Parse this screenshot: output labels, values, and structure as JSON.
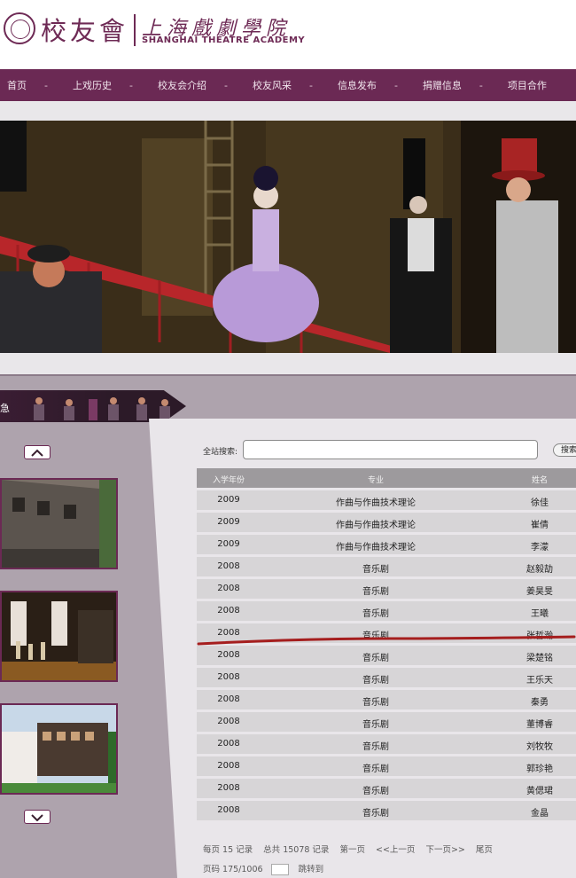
{
  "header": {
    "logo_left": "校友會",
    "logo_cn": "上海戲劇學院",
    "logo_en": "SHANGHAI THEATRE ACADEMY"
  },
  "nav": {
    "items": [
      "首页",
      "上戏历史",
      "校友会介绍",
      "校友风采",
      "信息发布",
      "捐赠信息",
      "项目合作"
    ],
    "separator": "-"
  },
  "sidebar": {
    "ribbon_label": "急",
    "up_icon": "chevron-up-icon",
    "down_icon": "chevron-down-icon"
  },
  "search": {
    "label": "全站搜索:",
    "value": "",
    "button_label": "搜索"
  },
  "table": {
    "headers": [
      "入学年份",
      "专业",
      "姓名"
    ],
    "rows": [
      [
        "2009",
        "作曲与作曲技术理论",
        "徐佳"
      ],
      [
        "2009",
        "作曲与作曲技术理论",
        "崔倩"
      ],
      [
        "2009",
        "作曲与作曲技术理论",
        "李濛"
      ],
      [
        "2008",
        "音乐剧",
        "赵毅劼"
      ],
      [
        "2008",
        "音乐剧",
        "姜昊旻"
      ],
      [
        "2008",
        "音乐剧",
        "王曦"
      ],
      [
        "2008",
        "音乐剧",
        "张哲瀚"
      ],
      [
        "2008",
        "音乐剧",
        "梁楚铭"
      ],
      [
        "2008",
        "音乐剧",
        "王乐天"
      ],
      [
        "2008",
        "音乐剧",
        "秦勇"
      ],
      [
        "2008",
        "音乐剧",
        "董博睿"
      ],
      [
        "2008",
        "音乐剧",
        "刘牧牧"
      ],
      [
        "2008",
        "音乐剧",
        "郭珍艳"
      ],
      [
        "2008",
        "音乐剧",
        "黄偲珺"
      ],
      [
        "2008",
        "音乐剧",
        "金晶"
      ]
    ],
    "highlight_color": "#a51e1e"
  },
  "pager": {
    "per_page": "每页 15 记录",
    "total": "总共 15078 记录",
    "first": "第一页",
    "prev": "<<上一页",
    "next": "下一页>>",
    "last": "尾页",
    "page_label": "页码 175/1006",
    "jump": "跳转到"
  },
  "colors": {
    "brand": "#6b2954",
    "panel_bg": "#aea3ad",
    "row_bg": "#d7d5d7",
    "header_bg": "#9d9a9d"
  }
}
